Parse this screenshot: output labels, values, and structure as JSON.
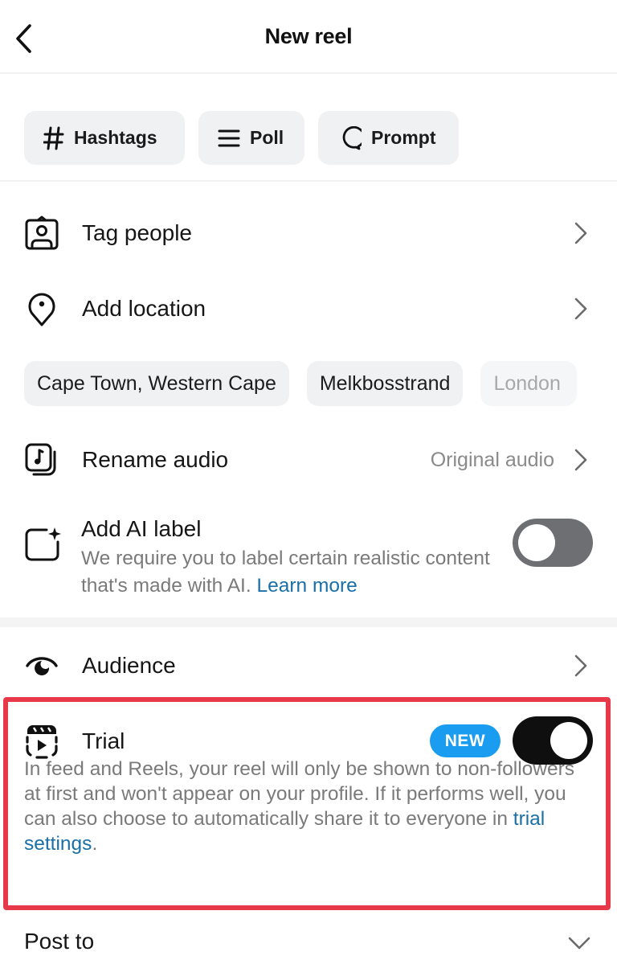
{
  "header": {
    "title": "New reel",
    "back_icon": "chevron-left-icon"
  },
  "chips": [
    {
      "label": "Hashtags",
      "icon": "hashtag-icon"
    },
    {
      "label": "Poll",
      "icon": "list-icon"
    },
    {
      "label": "Prompt",
      "icon": "speech-bubble-icon"
    }
  ],
  "rows": {
    "tag_people": {
      "label": "Tag people",
      "icon": "tag-person-icon"
    },
    "add_location": {
      "label": "Add location",
      "icon": "location-pin-icon"
    },
    "rename_audio": {
      "label": "Rename audio",
      "value": "Original audio",
      "icon": "audio-icon"
    },
    "audience": {
      "label": "Audience",
      "icon": "eye-icon"
    }
  },
  "location_suggestions": [
    "Cape Town, Western Cape",
    "Melkbosstrand",
    "London"
  ],
  "ai_label": {
    "title": "Add AI label",
    "description": "We require you to label certain realistic content that's made with AI.",
    "link": "Learn more",
    "toggle_on": false,
    "icon": "ai-sparkle-icon"
  },
  "trial": {
    "title": "Trial",
    "badge": "NEW",
    "toggle_on": true,
    "description": "In feed and Reels, your reel will only be shown to non-followers at first and won't appear on your profile. If it performs well, you can also choose to automatically share it to everyone in",
    "link": "trial settings",
    "suffix": ".",
    "icon": "reel-trial-icon",
    "highlight_color": "#e8394b"
  },
  "post_to": {
    "label": "Post to"
  },
  "colors": {
    "link": "#1a6fa8",
    "badge": "#1a9cf0",
    "toggle_off": "#6d6f73",
    "toggle_on": "#0f0f10"
  }
}
